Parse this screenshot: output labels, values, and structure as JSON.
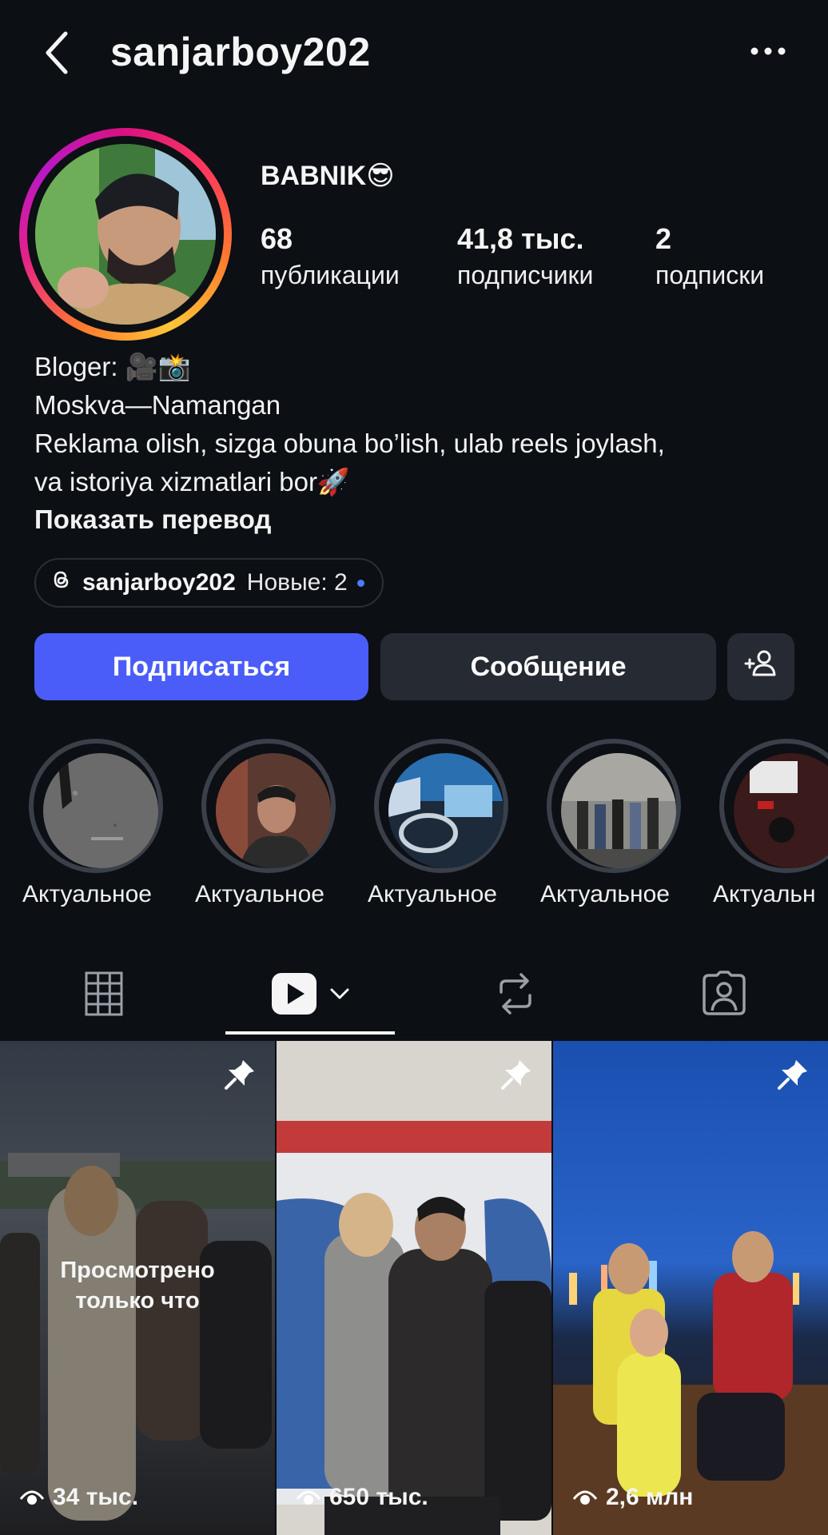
{
  "header": {
    "username": "sanjarboy202",
    "back_icon": "chevron-left-icon",
    "more_icon": "more-horizontal-icon"
  },
  "profile": {
    "display_name": "BABNIK😎",
    "stats": [
      {
        "value": "68",
        "label": "публикации"
      },
      {
        "value": "41,8 тыс.",
        "label": "подписчики"
      },
      {
        "value": "2",
        "label": "подписки"
      }
    ],
    "bio": {
      "line1": "Bloger: 🎥📸",
      "line2": "Moskva—Namangan",
      "line3": "Reklama olish, sizga obuna bo’lish, ulab reels joylash,",
      "line4": "va istoriya xizmatlari bor🚀",
      "show_translation": "Показать перевод"
    },
    "threads": {
      "handle": "sanjarboy202",
      "new_label": "Новые: 2"
    }
  },
  "actions": {
    "follow": "Подписаться",
    "message": "Сообщение",
    "add_user_icon": "add-user-icon"
  },
  "highlights": [
    {
      "label": "Актуальное"
    },
    {
      "label": "Актуальное"
    },
    {
      "label": "Актуальное"
    },
    {
      "label": "Актуальное"
    },
    {
      "label": "Актуальн"
    }
  ],
  "tabs": [
    {
      "name": "grid",
      "icon": "grid-icon"
    },
    {
      "name": "reels",
      "icon": "reels-icon",
      "active": true
    },
    {
      "name": "reposts",
      "icon": "repost-icon"
    },
    {
      "name": "tagged",
      "icon": "tagged-icon"
    }
  ],
  "reels": [
    {
      "views": "34 тыс.",
      "pinned": true,
      "overlay": "Просмотрено только что"
    },
    {
      "views": "650 тыс.",
      "pinned": true
    },
    {
      "views": "2,6 млн",
      "pinned": true
    }
  ],
  "colors": {
    "background": "#0c0f14",
    "follow_button": "#4a5df9",
    "secondary_button": "#262a33",
    "threads_dot": "#4a7cff"
  }
}
